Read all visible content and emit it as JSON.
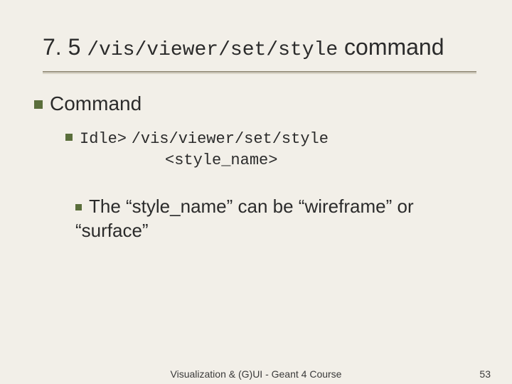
{
  "title": {
    "number": "7. 5",
    "command_path": "/vis/viewer/set/style",
    "tail": "command"
  },
  "body": {
    "lvl1_label": "Command",
    "lvl2_prefix": "Idle>",
    "lvl2_code1": "/vis/viewer/set/style",
    "lvl2_code2": "<style_name>",
    "lvl3_text": "The “style_name” can be “wireframe” or “surface”"
  },
  "footer": {
    "center": "Visualization & (G)UI - Geant 4 Course",
    "page": "53"
  }
}
